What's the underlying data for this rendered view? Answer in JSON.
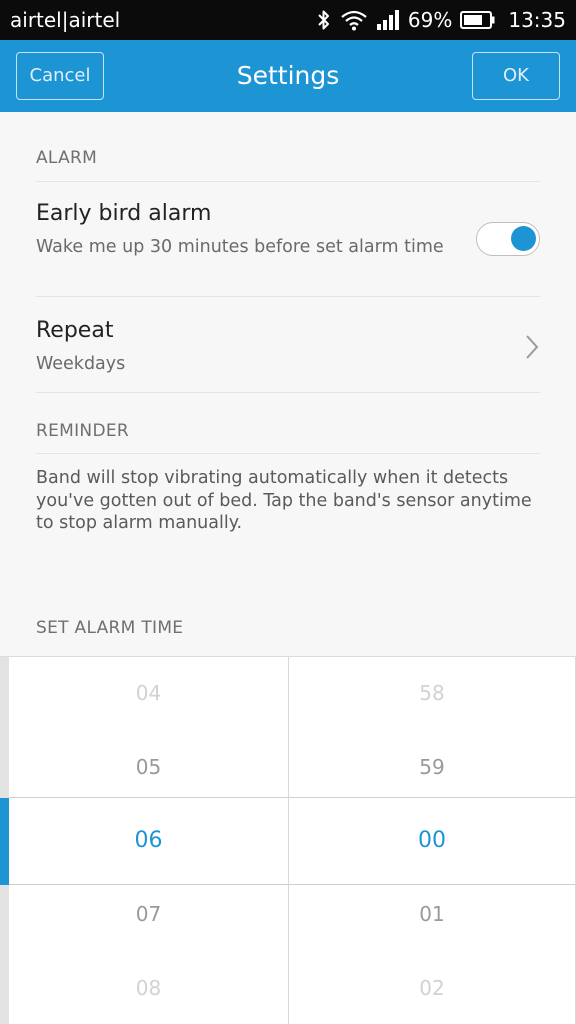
{
  "status_bar": {
    "carrier": "airtel|airtel",
    "battery": "69%",
    "time": "13:35"
  },
  "header": {
    "title": "Settings",
    "cancel_label": "Cancel",
    "ok_label": "OK"
  },
  "alarm_section": {
    "label": "ALARM",
    "early_bird": {
      "title": "Early bird alarm",
      "subtitle": "Wake me up 30 minutes before set alarm time",
      "enabled": true
    },
    "repeat": {
      "title": "Repeat",
      "value": "Weekdays"
    }
  },
  "reminder_section": {
    "label": "REMINDER",
    "text": "Band will stop vibrating automatically when it detects you've gotten out of bed. Tap the band's sensor anytime to stop alarm manually."
  },
  "time_section": {
    "label": "SET ALARM TIME",
    "hours": [
      "04",
      "05",
      "06",
      "07",
      "08"
    ],
    "minutes": [
      "58",
      "59",
      "00",
      "01",
      "02"
    ],
    "selected_hour": "06",
    "selected_minute": "00"
  },
  "colors": {
    "accent": "#1d95d5",
    "status_bar": "#0b0b0b",
    "background": "#f7f7f7"
  },
  "icons": {
    "status": [
      "bluetooth-icon",
      "wifi-icon",
      "signal-icon",
      "battery-icon"
    ],
    "repeat": "chevron-right-icon"
  }
}
